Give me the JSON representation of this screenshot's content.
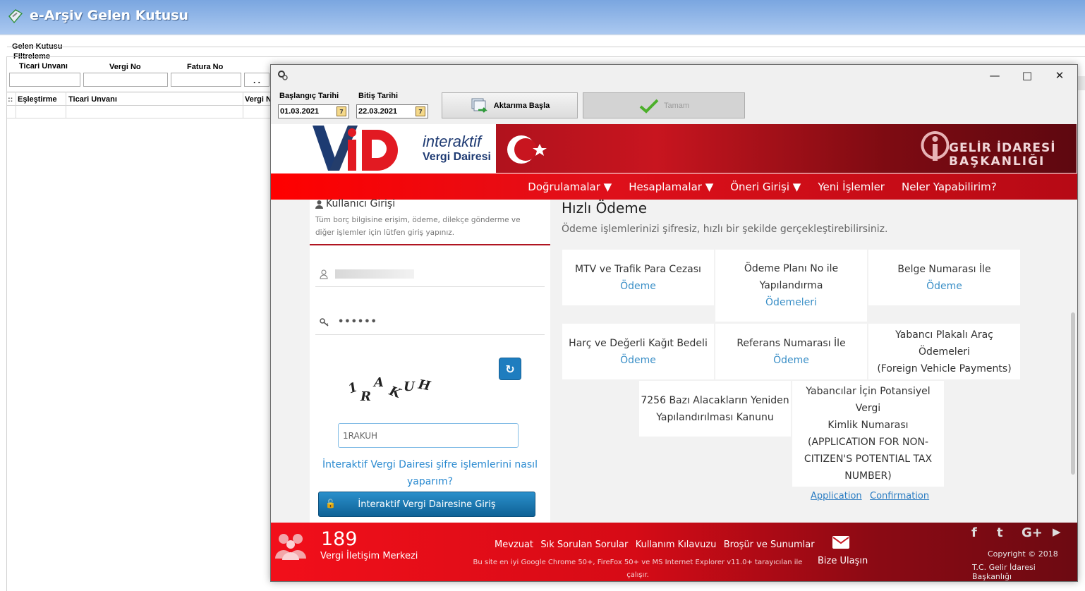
{
  "app": {
    "title": "e-Arşiv Gelen Kutusu",
    "group_label": "Gelen Kutusu",
    "filter_label": "Filtreleme",
    "filter_fields": [
      "Ticari Unvanı",
      "Vergi No",
      "Fatura No"
    ],
    "ellipsis": ". .",
    "grid_headers": [
      "Eşleştirme",
      "Ticari Unvanı",
      "Vergi N"
    ],
    "grid_marker": "::"
  },
  "popup": {
    "start_label": "Başlangıç Tarihi",
    "start_value": "01.03.2021",
    "end_label": "Bitiş Tarihi",
    "end_value": "22.03.2021",
    "transfer_button": "Aktarıma Başla",
    "ok_button": "Tamam",
    "cal_glyph": "7"
  },
  "web": {
    "logo_line1": "interaktif",
    "logo_line2": "Vergi Dairesi",
    "gib_line1": "GELİR İDARESİ",
    "gib_line2": "BAŞKANLIĞI",
    "nav": [
      {
        "label": "Doğrulamalar ▼"
      },
      {
        "label": "Hesaplamalar ▼"
      },
      {
        "label": "Öneri Girişi ▼"
      },
      {
        "label": "Yeni İşlemler"
      },
      {
        "label": "Neler Yapabilirim?"
      }
    ],
    "login": {
      "title": "Kullanıcı Girişi",
      "desc": "Tüm borç bilgisine erişim, ödeme, dilekçe gönderme ve diğer işlemler için lütfen giriş yapınız.",
      "password_mask": "••••••",
      "captcha_chars": [
        "1",
        "R",
        "A",
        "K",
        "U",
        "H"
      ],
      "captcha_input": "1RAKUH",
      "help_link": "İnteraktif Vergi Dairesi şifre işlemlerini nasıl yaparım?",
      "login_button": "İnteraktif Vergi Dairesine Giriş"
    },
    "quick_pay": {
      "title": "Hızlı Ödeme",
      "subtitle": "Ödeme işlemlerinizi şifresiz, hızlı bir şekilde gerçekleştirebilirsiniz.",
      "boxes": [
        {
          "lines": [
            "MTV ve Trafik Para Cezası"
          ],
          "link": "Ödeme"
        },
        {
          "lines": [
            "Ödeme Planı No ile",
            "Yapılandırma"
          ],
          "link": "Ödemeleri"
        },
        {
          "lines": [
            "Belge Numarası İle"
          ],
          "link": "Ödeme"
        },
        {
          "lines": [
            "Harç ve Değerli Kağıt Bedeli"
          ],
          "link": "Ödeme"
        },
        {
          "lines": [
            "Referans Numarası İle"
          ],
          "link": "Ödeme"
        },
        {
          "lines": [
            "Yabancı Plakalı Araç Ödemeleri",
            "(Foreign Vehicle Payments)"
          ],
          "link": ""
        },
        {
          "lines": [
            "7256 Bazı Alacakların Yeniden",
            "Yapılandırılması Kanunu"
          ],
          "link": ""
        },
        {
          "lines": [
            "Yabancılar İçin Potansiyel Vergi",
            "Kimlik Numarası",
            "(APPLICATION FOR NON-",
            "CITIZEN'S POTENTIAL TAX",
            "NUMBER)"
          ],
          "link": ""
        }
      ],
      "application_link": "Application",
      "confirmation_link": "Confirmation"
    },
    "footer": {
      "phone": "189",
      "phone_label": "Vergi İletişim Merkezi",
      "links": [
        "Mevzuat",
        "Sık Sorulan Sorular",
        "Kullanım Kılavuzu",
        "Broşür ve Sunumlar"
      ],
      "browser_note_1": "Bu site en iyi Google Chrome 50+, FireFox 50+ ve MS Internet Explorer v11.0+ tarayıcılan ile",
      "browser_note_2": "çalışır.",
      "contact": "Bize Ulaşın",
      "copyright_1": "Copyright © 2018",
      "copyright_2": "T.C. Gelir İdaresi Başkanlığı",
      "social": [
        "f",
        "t",
        "G+",
        "▶"
      ]
    }
  }
}
